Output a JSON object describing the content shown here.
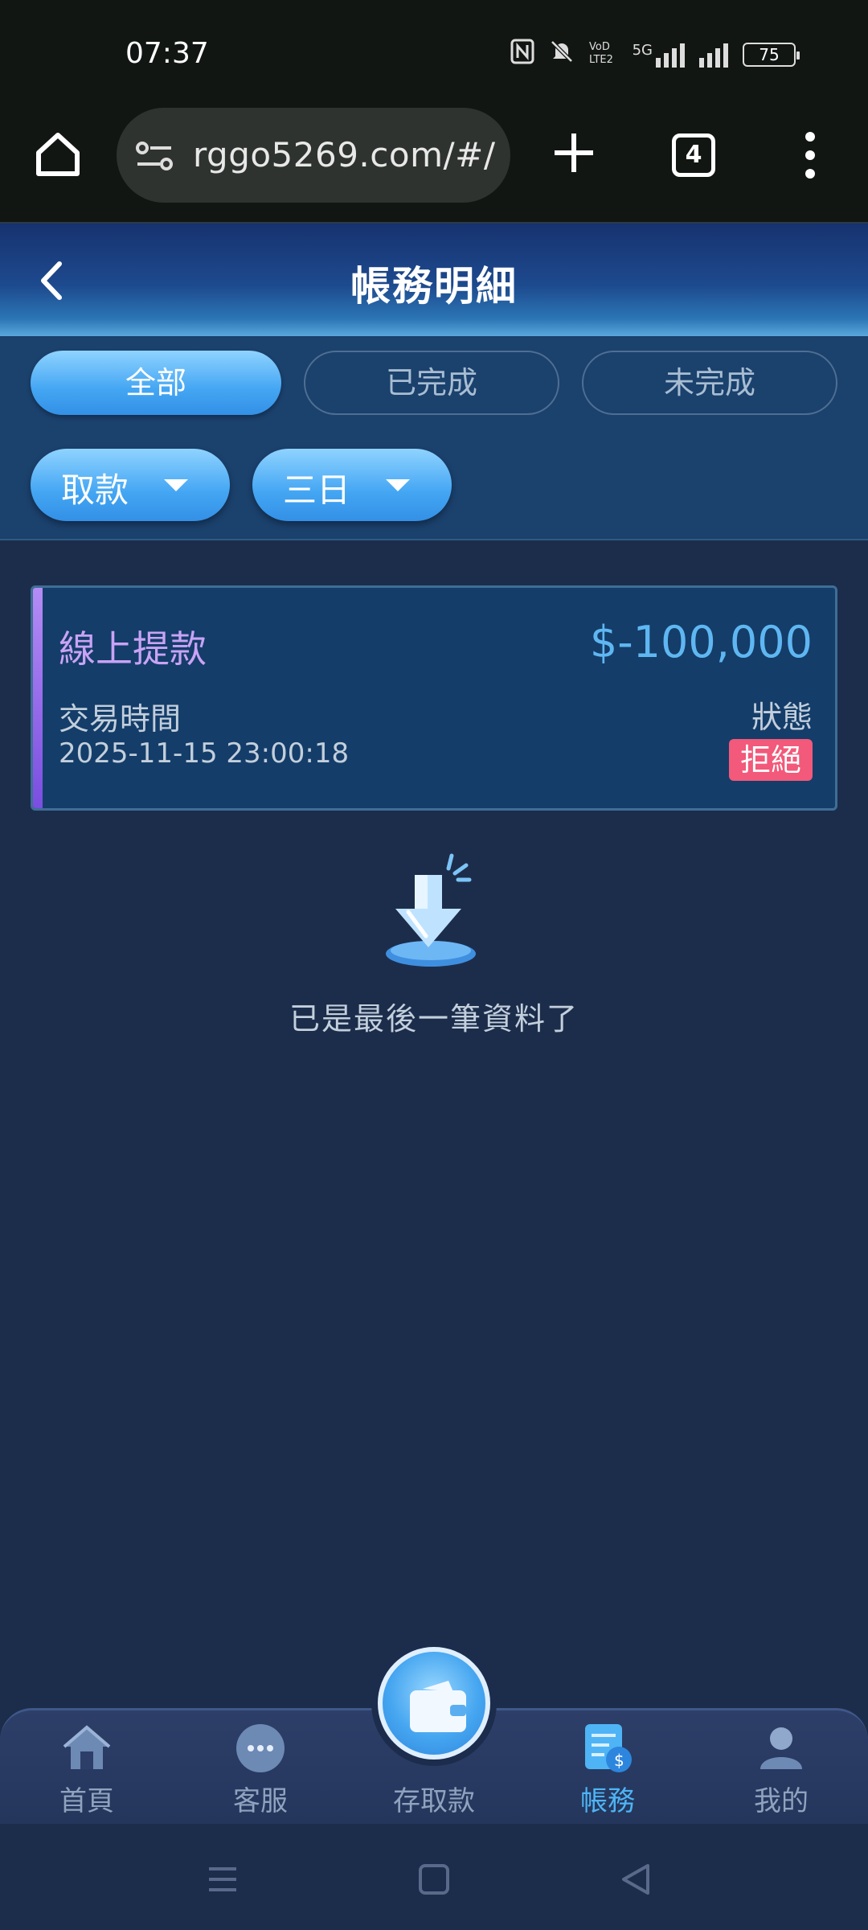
{
  "status_bar": {
    "time": "07:37",
    "battery": "75",
    "network": "5G"
  },
  "browser": {
    "url": "rggo5269.com/#/",
    "tab_count": "4"
  },
  "header": {
    "title": "帳務明細"
  },
  "filters": {
    "segments": [
      "全部",
      "已完成",
      "未完成"
    ],
    "active_segment": "全部",
    "type_dropdown": "取款",
    "range_dropdown": "三日"
  },
  "records": [
    {
      "title": "線上提款",
      "amount": "$-100,000",
      "time_label": "交易時間",
      "time": "2025-11-15 23:00:18",
      "status_label": "狀態",
      "status": "拒絕"
    }
  ],
  "end_message": "已是最後一筆資料了",
  "bottom_nav": [
    {
      "label": "首頁",
      "icon": "home-icon",
      "active": false
    },
    {
      "label": "客服",
      "icon": "chat-icon",
      "active": false
    },
    {
      "label": "存取款",
      "icon": "wallet-icon",
      "active": false
    },
    {
      "label": "帳務",
      "icon": "bill-icon",
      "active": true
    },
    {
      "label": "我的",
      "icon": "user-icon",
      "active": false
    }
  ],
  "colors": {
    "accent": "#44a6f3",
    "amount": "#5fb7f2",
    "status_rejected": "#f2597a",
    "record_title": "#c9a3f5",
    "nav_active": "#4eb4f5"
  }
}
